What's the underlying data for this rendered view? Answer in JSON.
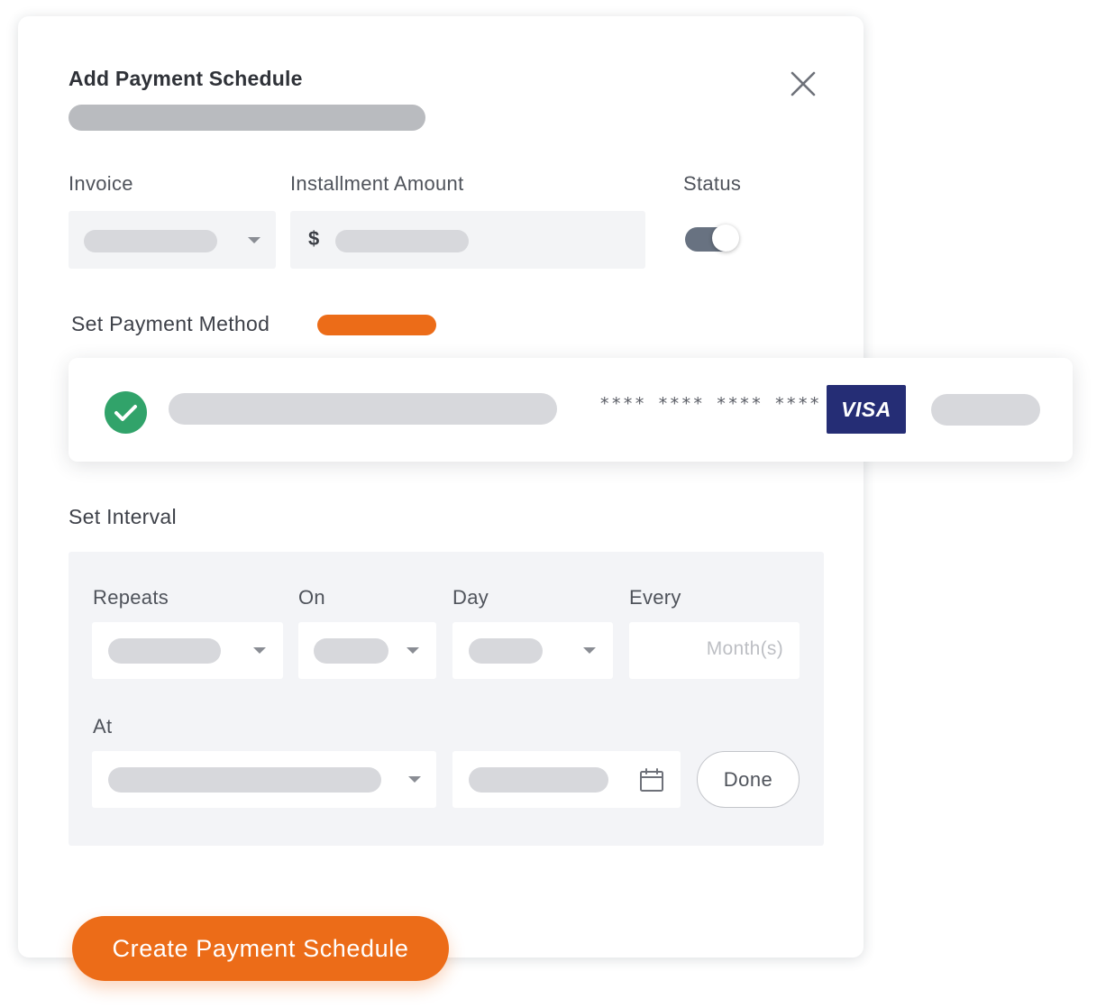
{
  "modal": {
    "title": "Add Payment Schedule"
  },
  "fields": {
    "invoice_label": "Invoice",
    "amount_label": "Installment Amount",
    "currency_symbol": "$",
    "status_label": "Status",
    "status_on": true
  },
  "payment_method": {
    "heading": "Set Payment Method",
    "masked_number": "**** **** **** ****",
    "card_brand": "VISA"
  },
  "interval": {
    "heading": "Set Interval",
    "repeats_label": "Repeats",
    "on_label": "On",
    "day_label": "Day",
    "every_label": "Every",
    "every_placeholder": "Month(s)",
    "at_label": "At",
    "done_label": "Done"
  },
  "actions": {
    "create_label": "Create Payment Schedule"
  },
  "colors": {
    "accent": "#ec6c18",
    "success": "#31a36a",
    "visa_blue": "#252d75",
    "toggle_track": "#687281"
  },
  "icons": {
    "close": "close-icon",
    "dropdown": "chevron-down-icon",
    "check": "check-icon",
    "calendar": "calendar-icon"
  }
}
